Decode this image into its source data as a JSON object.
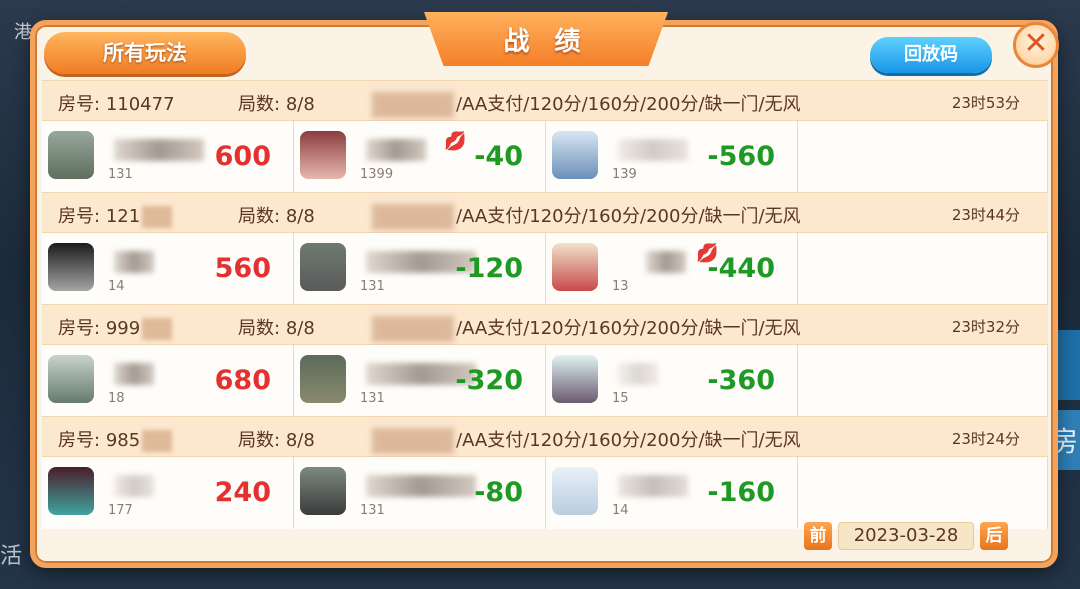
{
  "background": {
    "left_text": "港",
    "bottom_left_text": "活",
    "right_text": "房"
  },
  "dialog": {
    "title": "战 绩",
    "all_modes_label": "所有玩法",
    "replay_code_label": "回放码",
    "close_label": "✕"
  },
  "labels": {
    "room_prefix": "房号:",
    "games_prefix": "局数:"
  },
  "rounds": [
    {
      "room": "110477",
      "games": "8/8",
      "rules": "/AA支付/120分/160分/200分/缺一门/无风",
      "time": "23时53分",
      "players": [
        {
          "id": "131",
          "score": "600"
        },
        {
          "id": "1399",
          "score": "-40"
        },
        {
          "id": "139",
          "score": "-560"
        }
      ]
    },
    {
      "room": "121",
      "games": "8/8",
      "rules": "/AA支付/120分/160分/200分/缺一门/无风",
      "time": "23时44分",
      "players": [
        {
          "id": "14",
          "score": "560"
        },
        {
          "id": "131",
          "score": "-120"
        },
        {
          "id": "13",
          "score": "-440"
        }
      ]
    },
    {
      "room": "999",
      "games": "8/8",
      "rules": "/AA支付/120分/160分/200分/缺一门/无风",
      "time": "23时32分",
      "players": [
        {
          "id": "18",
          "score": "680"
        },
        {
          "id": "131",
          "score": "-320"
        },
        {
          "id": "15",
          "score": "-360"
        }
      ]
    },
    {
      "room": "985",
      "games": "8/8",
      "rules": "/AA支付/120分/160分/200分/缺一门/无风",
      "time": "23时24分",
      "players": [
        {
          "id": "177",
          "score": "240"
        },
        {
          "id": "131",
          "score": "-80"
        },
        {
          "id": "14",
          "score": "-160"
        }
      ]
    }
  ],
  "footer": {
    "prev_label": "前",
    "date": "2023-03-28",
    "next_label": "后"
  },
  "colors": {
    "positive": "#e53030",
    "negative": "#1e9a24",
    "accent": "#f47f28",
    "replay": "#1996e6"
  },
  "icons": {
    "lips": "lips-icon",
    "close": "close-icon"
  }
}
